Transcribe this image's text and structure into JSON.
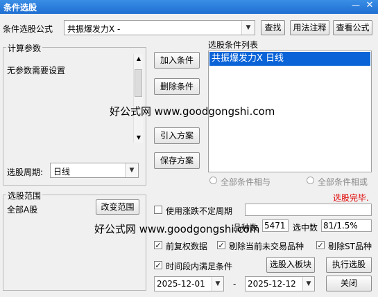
{
  "window": {
    "title": "条件选股",
    "minimize_glyph": "—",
    "close_glyph": "✕"
  },
  "formula": {
    "label": "条件选股公式",
    "value": "共振爆发力X -",
    "find_button": "查找",
    "usage_button": "用法注释",
    "view_button": "查看公式"
  },
  "params": {
    "group_label": "计算参数",
    "text": "无参数需要设置",
    "period_label": "选股周期:",
    "period_value": "日线"
  },
  "buttons": {
    "add": "加入条件",
    "delete": "删除条件",
    "import": "引入方案",
    "save": "保存方案"
  },
  "conditions": {
    "label": "选股条件列表",
    "items": [
      "共振爆发力X  日线"
    ],
    "radio_and": "全部条件相与",
    "radio_or": "全部条件相或"
  },
  "status": {
    "text": "选股完毕.",
    "color": "#e00000"
  },
  "scope": {
    "group_label": "选股范围",
    "value": "全部A股",
    "change_button": "改变范围"
  },
  "options": {
    "use_period_label": "使用涨跌不定周期",
    "total_label": "品种数",
    "total_value": "5471",
    "selected_label": "选中数",
    "selected_value": "81/1.5%",
    "fq_label": "前复权数据",
    "remove_untraded_label": "剔除当前未交易品种",
    "remove_st_label": "剔除ST品种",
    "time_range_label": "时间段内满足条件"
  },
  "dates": {
    "start": "2025-12-01",
    "separator": "-",
    "end": "2025-12-12"
  },
  "actions": {
    "to_block": "选股入板块",
    "run": "执行选股",
    "close": "关闭"
  },
  "checked_glyph": "✓",
  "watermarks": [
    "好公式网 www.goodgongshi.com",
    "好公式网 www.goodgongshi.com"
  ]
}
